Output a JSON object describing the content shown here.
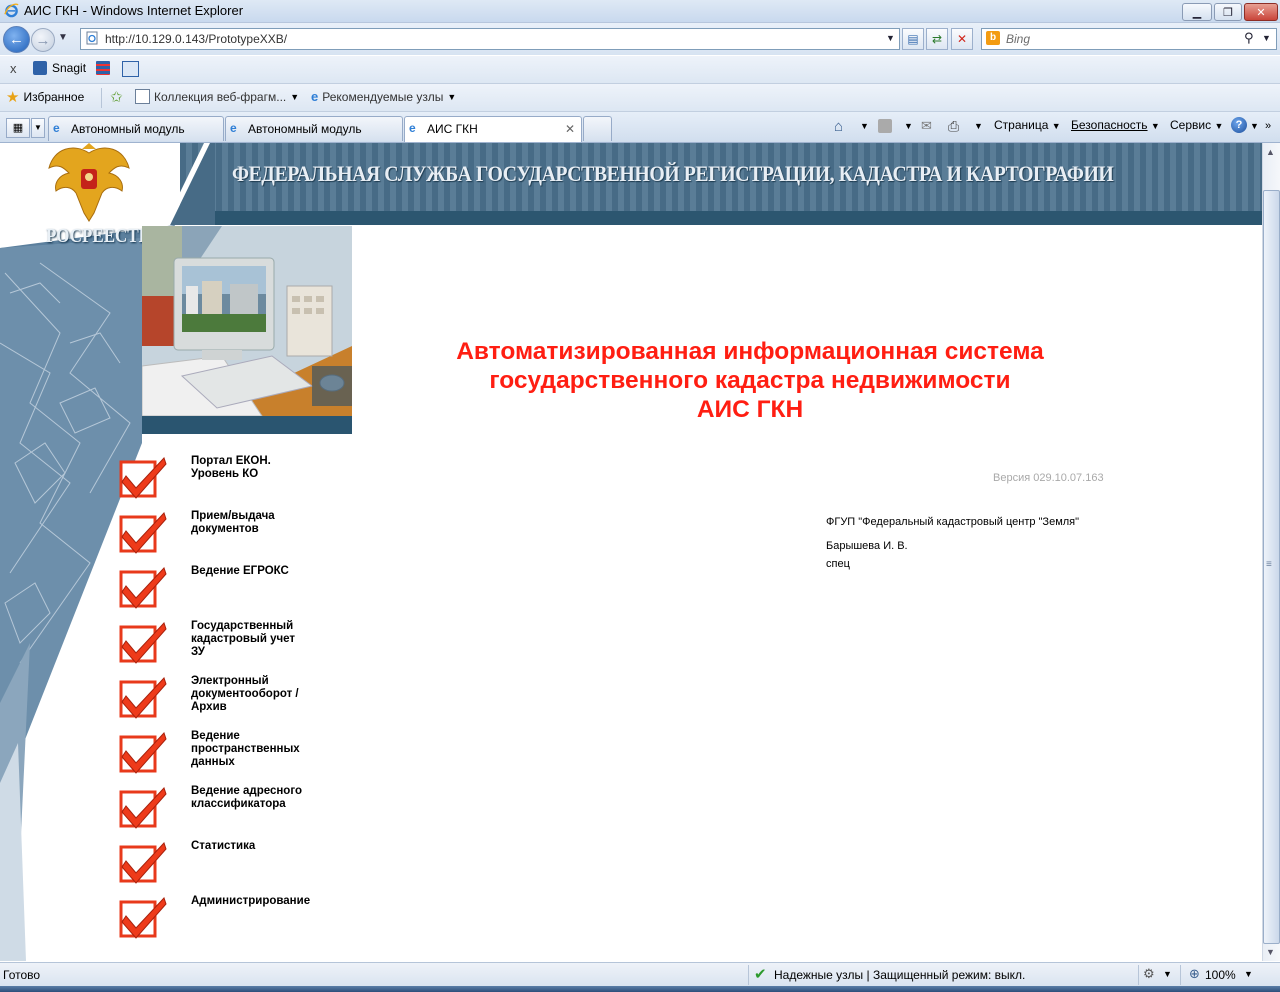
{
  "window": {
    "title": "АИС ГКН - Windows Internet Explorer",
    "minimize_label": "▁",
    "maximize_label": "❐",
    "close_label": "✕"
  },
  "address_bar": {
    "url": "http://10.129.0.143/PrototypeXXB/",
    "search_placeholder": "Bing"
  },
  "snagit_bar": {
    "close_label": "x",
    "snagit_label": "Snagit"
  },
  "favorites_bar": {
    "favorites_label": "Избранное",
    "gallery_label": "Коллекция веб-фрагм...",
    "suggested_label": "Рекомендуемые узлы"
  },
  "tabs": [
    {
      "label": "Автономный модуль",
      "active": false
    },
    {
      "label": "Автономный модуль",
      "active": false
    },
    {
      "label": "АИС ГКН",
      "active": true
    }
  ],
  "tab_close_label": "✕",
  "command_bar": {
    "page": "Страница",
    "safety": "Безопасность",
    "tools": "Сервис"
  },
  "page": {
    "header_title": "ФЕДЕРАЛЬНАЯ СЛУЖБА ГОСУДАРСТВЕННОЙ РЕГИСТРАЦИИ, КАДАСТРА И КАРТОГРАФИИ",
    "logo_text": "РОСРЕЕСТР",
    "main_title": [
      "Автоматизированная информационная система",
      "государственного кадастра недвижимости",
      "АИС ГКН"
    ],
    "version": "Версия 029.10.07.163",
    "organization": "ФГУП \"Федеральный кадастровый центр \"Земля\"",
    "user_name": "Барышева И. В.",
    "user_role": "спец",
    "menu": [
      "Портал ЕКОН.\nУровень КО",
      "Прием/выдача\nдокументов",
      "Ведение ЕГРОКС",
      "Государственный\nкадастровый учет\nЗУ",
      "Электронный\nдокументооборот /\nАрхив",
      "Ведение\nпространственных\nданных",
      "Ведение адресного\nклассификатора",
      "Статистика",
      "Администрирование"
    ]
  },
  "status_bar": {
    "status": "Готово",
    "zone": "Надежные узлы | Защищенный режим: выкл.",
    "zoom": "100%"
  },
  "colors": {
    "title_red": "#ff1e12",
    "header_blue": "#476b86",
    "check_red": "#ee3a1a"
  }
}
